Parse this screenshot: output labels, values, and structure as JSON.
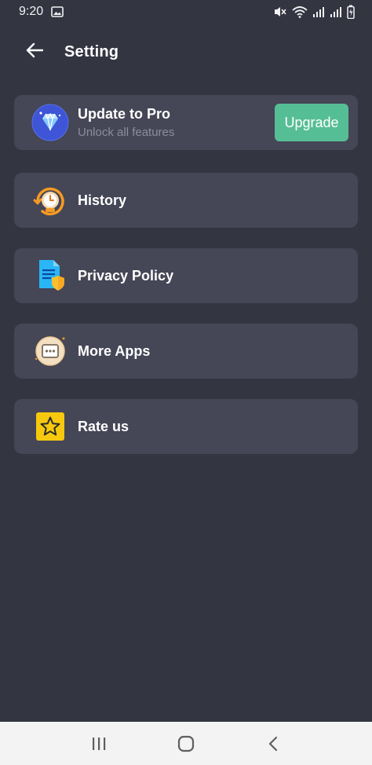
{
  "status_bar": {
    "time": "9:20",
    "icons": [
      "image-icon",
      "mute-icon",
      "wifi-icon",
      "signal-icon",
      "signal-icon",
      "battery-icon"
    ]
  },
  "header": {
    "title": "Setting",
    "back_icon": "arrow-left-icon"
  },
  "pro_card": {
    "title": "Update to Pro",
    "subtitle": "Unlock all features",
    "button_label": "Upgrade",
    "icon": "diamond-icon",
    "button_color": "#56be95"
  },
  "menu": {
    "items": [
      {
        "label": "History",
        "icon": "history-clock-icon"
      },
      {
        "label": "Privacy Policy",
        "icon": "privacy-document-shield-icon"
      },
      {
        "label": "More Apps",
        "icon": "more-apps-icon"
      },
      {
        "label": "Rate us",
        "icon": "star-icon"
      }
    ]
  },
  "colors": {
    "background": "#333541",
    "card": "#454656",
    "accent": "#56be95",
    "subtitle": "#8c8e9c"
  },
  "nav_bar": {
    "icons": [
      "recent-apps-icon",
      "home-icon",
      "back-icon"
    ]
  }
}
